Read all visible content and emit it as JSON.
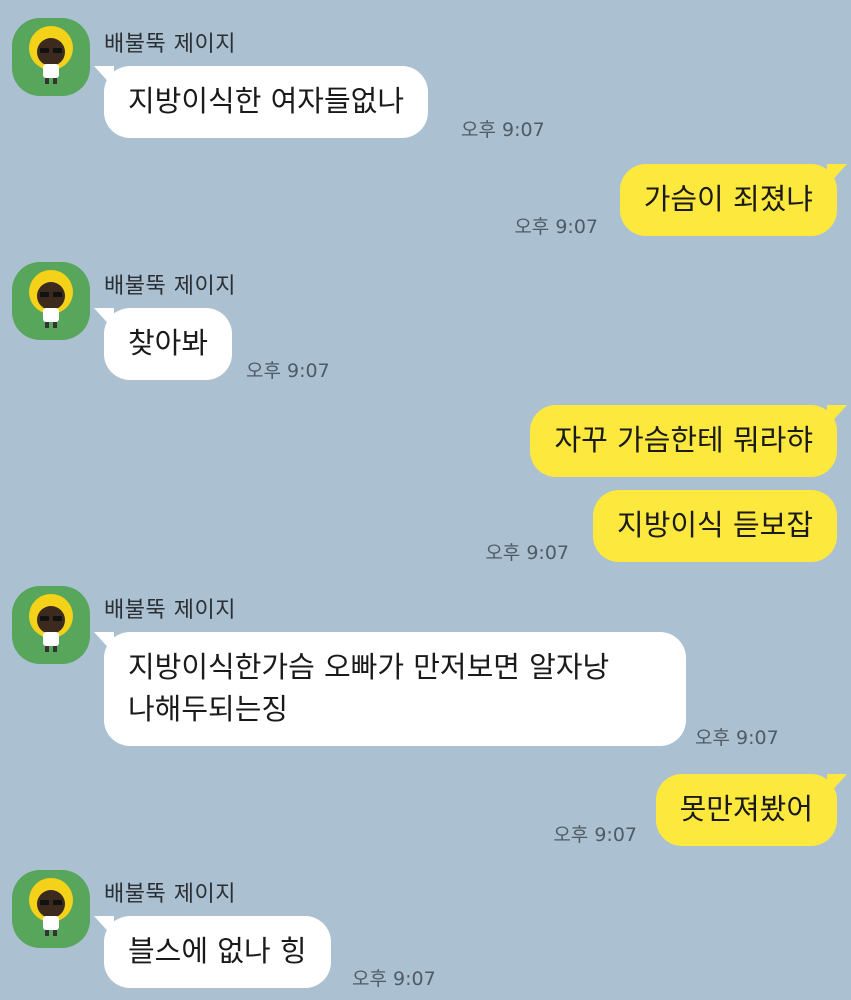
{
  "chat": {
    "sender_name": "배불뚝 제이지",
    "messages": [
      {
        "id": 1,
        "dir": "in",
        "text": "지방이식한 여자들없나",
        "time": "오후 9:07"
      },
      {
        "id": 2,
        "dir": "out",
        "text": "가슴이 죄졌냐",
        "time": "오후 9:07"
      },
      {
        "id": 3,
        "dir": "in",
        "text": "찾아봐",
        "time": "오후 9:07"
      },
      {
        "id": 4,
        "dir": "out",
        "text": "자꾸 가슴한테 뭐라햐",
        "time": ""
      },
      {
        "id": 5,
        "dir": "out",
        "text": "지방이식 듣보잡",
        "time": "오후 9:07"
      },
      {
        "id": 6,
        "dir": "in",
        "lines": [
          "지방이식한가슴 오빠가 만저보면 알자낭",
          "나해두되는징"
        ],
        "time": "오후 9:07"
      },
      {
        "id": 7,
        "dir": "out",
        "text": "못만져봤어",
        "time": "오후 9:07"
      },
      {
        "id": 8,
        "dir": "in",
        "text": "블스에 없나 힝",
        "time": "오후 9:07"
      }
    ]
  },
  "colors": {
    "background": "#abc1d1",
    "incoming_bubble": "#ffffff",
    "outgoing_bubble": "#fde93e",
    "avatar_bg": "#58a55c"
  },
  "icons": {
    "avatar": "character-avatar-icon"
  }
}
